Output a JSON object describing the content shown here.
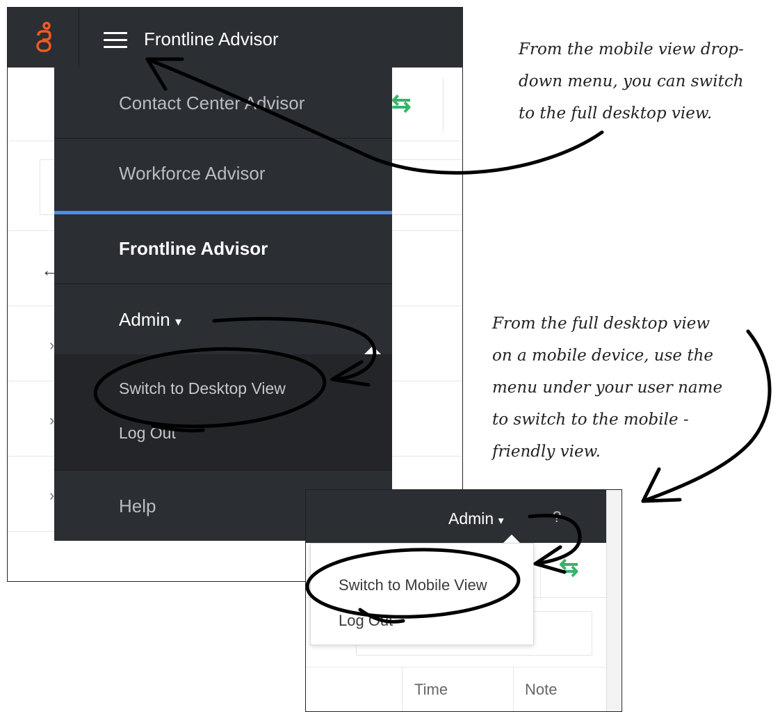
{
  "mobile_view": {
    "app_title": "Frontline Advisor",
    "logo_icon": "genesys-logo-icon",
    "menu_icon": "hamburger-menu-icon",
    "menu_items": [
      {
        "label": "Contact Center Advisor"
      },
      {
        "label": "Workforce Advisor"
      },
      {
        "label": "Frontline Advisor",
        "active": true
      },
      {
        "label": "Admin"
      },
      {
        "label": "Help"
      }
    ],
    "admin_caret": "▾",
    "admin_submenu": [
      {
        "label": "Switch to Desktop View"
      },
      {
        "label": "Log Out"
      }
    ]
  },
  "desktop_view": {
    "user_menu_label": "Admin",
    "user_menu_caret": "▾",
    "help_glyph": "?",
    "dropdown_items": [
      {
        "label": "Switch to Mobile View"
      },
      {
        "label": "Log Out"
      }
    ],
    "table_headers": [
      "Time",
      "Note"
    ]
  },
  "annotations": {
    "mobile_note": [
      "From the mobile view drop-",
      "down menu, you can switch",
      "to the full desktop view."
    ],
    "desktop_note": [
      "From the full desktop view",
      "on a mobile device, use the",
      "menu under your user name",
      "to switch to the mobile -",
      "friendly view."
    ]
  },
  "colors": {
    "header_bg": "#2b2e33",
    "accent_orange": "#ee5a24",
    "active_bar": "#4d8fe3",
    "swap_arrow_green": "#38b36b"
  }
}
